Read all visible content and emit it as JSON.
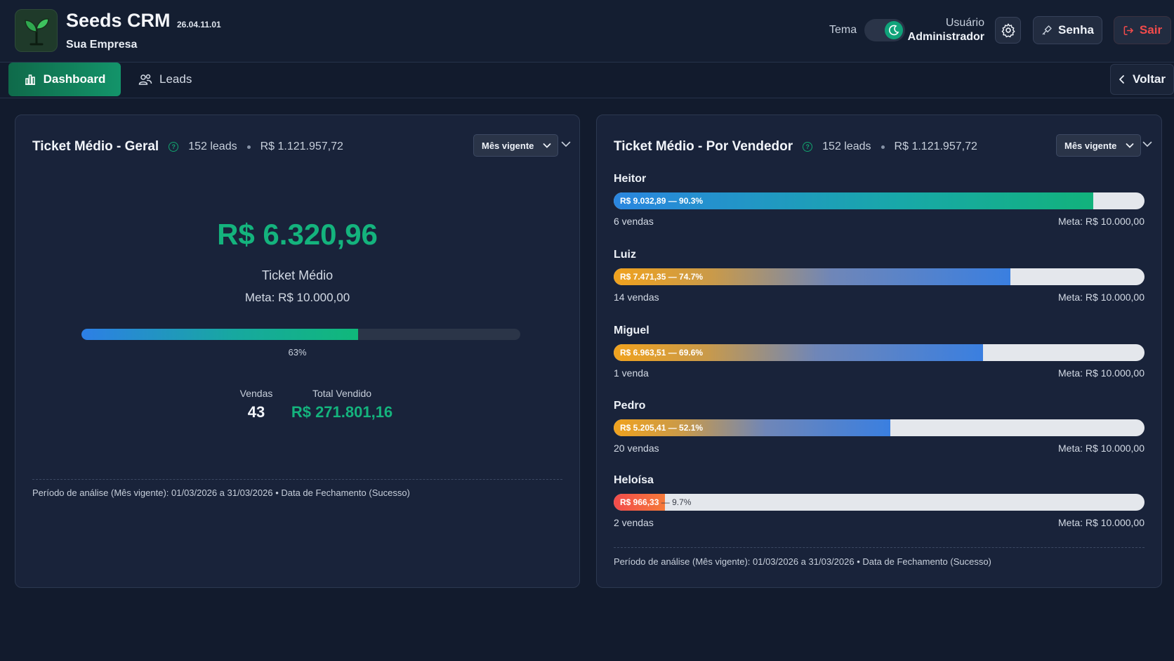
{
  "app": {
    "title": "Seeds CRM",
    "version": "26.04.11.01",
    "company": "Sua Empresa"
  },
  "header": {
    "theme_label": "Tema",
    "user_label": "Usuário",
    "user_role": "Administrador",
    "password_label": "Senha",
    "logout_label": "Sair"
  },
  "nav": {
    "tabs": [
      {
        "label": "Dashboard",
        "active": true
      },
      {
        "label": "Leads",
        "active": false
      }
    ],
    "back_label": "Voltar"
  },
  "colors": {
    "accent_green": "#14b37d",
    "danger_red": "#f24b4b",
    "background": "#121b2d"
  },
  "ticket_geral": {
    "title": "Ticket Médio - Geral",
    "leads": "152 leads",
    "total": "R$ 1.121.957,72",
    "period_select": "Mês vigente",
    "value": "R$ 6.320,96",
    "value_label": "Ticket Médio",
    "meta": "Meta: R$ 10.000,00",
    "progress_percent": 63,
    "progress_label": "63%",
    "sales_label": "Vendas",
    "sales_value": "43",
    "total_sold_label": "Total Vendido",
    "total_sold_value": "R$ 271.801,16",
    "footnote": "Período de análise (Mês vigente): 01/03/2026 a 31/03/2026 • Data de Fechamento (Sucesso)"
  },
  "ticket_vendedor": {
    "title": "Ticket Médio - Por Vendedor",
    "leads": "152 leads",
    "total": "R$ 1.121.957,72",
    "period_select": "Mês vigente",
    "sellers": [
      {
        "name": "Heitor",
        "bar_label": "R$ 9.032,89 — 90.3%",
        "percent": 90.3,
        "sales": "6 vendas",
        "meta": "Meta: R$ 10.000,00",
        "style": "blue-green"
      },
      {
        "name": "Luiz",
        "bar_label": "R$ 7.471,35 — 74.7%",
        "percent": 74.7,
        "sales": "14 vendas",
        "meta": "Meta: R$ 10.000,00",
        "style": "orange-blue"
      },
      {
        "name": "Miguel",
        "bar_label": "R$ 6.963,51 — 69.6%",
        "percent": 69.6,
        "sales": "1 venda",
        "meta": "Meta: R$ 10.000,00",
        "style": "orange-blue"
      },
      {
        "name": "Pedro",
        "bar_label": "R$ 5.205,41 — 52.1%",
        "percent": 52.1,
        "sales": "20 vendas",
        "meta": "Meta: R$ 10.000,00",
        "style": "orange-blue"
      },
      {
        "name": "Heloísa",
        "bar_label_value": "R$ 966,33",
        "bar_label_pct": "— 9.7%",
        "percent": 9.7,
        "sales": "2 vendas",
        "meta": "Meta: R$ 10.000,00",
        "style": "red"
      }
    ],
    "footnote": "Período de análise (Mês vigente): 01/03/2026 a 31/03/2026 • Data de Fechamento (Sucesso)"
  },
  "icons": {
    "logo": "sprout-icon",
    "theme": "moon-icon",
    "settings": "gear-icon",
    "password": "key-icon",
    "logout": "logout-icon",
    "dashboard": "bar-chart-icon",
    "leads": "users-icon",
    "back": "chevron-left-icon",
    "help": "help-circle-icon",
    "select": "chevron-down-icon",
    "collapse": "chevron-down-icon"
  }
}
